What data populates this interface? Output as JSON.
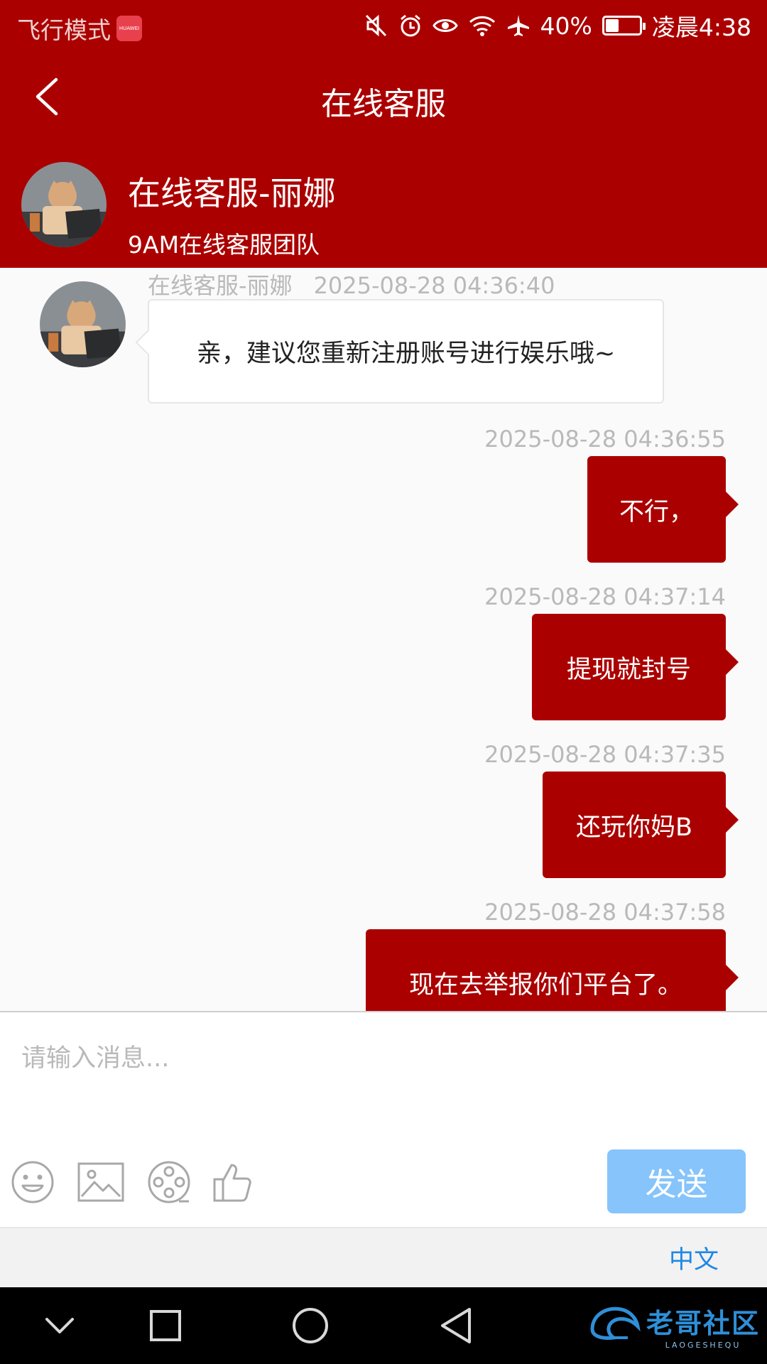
{
  "status_bar": {
    "mode": "飞行模式",
    "badge": "HUAWEI",
    "battery": "40%",
    "battery_level": 0.4,
    "time": "凌晨4:38"
  },
  "header": {
    "title": "在线客服"
  },
  "agent": {
    "name": "在线客服-丽娜",
    "team": "9AM在线客服团队"
  },
  "messages": {
    "incoming": [
      {
        "sender": "在线客服-丽娜",
        "time": "2025-08-28 04:36:40",
        "text": "亲，建议您重新注册账号进行娱乐哦~"
      }
    ],
    "outgoing": [
      {
        "time": "2025-08-28 04:36:55",
        "text": "不行，"
      },
      {
        "time": "2025-08-28 04:37:14",
        "text": "提现就封号"
      },
      {
        "time": "2025-08-28 04:37:35",
        "text": "还玩你妈B"
      },
      {
        "time": "2025-08-28 04:37:58",
        "text": "现在去举报你们平台了。"
      }
    ]
  },
  "composer": {
    "placeholder": "请输入消息...",
    "send_label": "发送",
    "language": "中文"
  },
  "watermark": {
    "main": "老哥社区",
    "sub": "LAOGESHEQU"
  },
  "colors": {
    "brand_red": "#ab0000",
    "send_blue": "#86c4fb",
    "link_blue": "#1e88e5"
  },
  "icons": [
    "back-arrow-icon",
    "mute-icon",
    "alarm-icon",
    "eye-icon",
    "wifi-icon",
    "airplane-icon",
    "battery-icon",
    "emoji-icon",
    "image-icon",
    "video-icon",
    "thumbs-up-icon",
    "nav-down-icon",
    "nav-square-icon",
    "nav-circle-icon",
    "nav-back-icon"
  ]
}
